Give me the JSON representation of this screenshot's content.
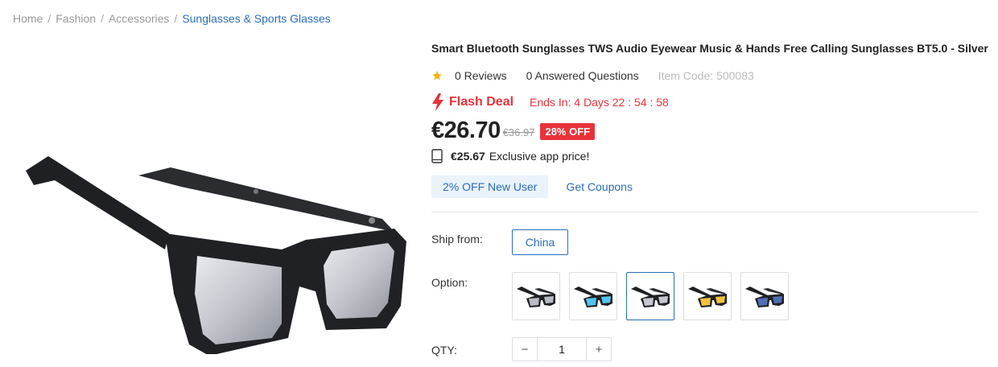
{
  "breadcrumb": {
    "items": [
      "Home",
      "Fashion",
      "Accessories"
    ],
    "current": "Sunglasses & Sports Glasses",
    "separator": "/"
  },
  "product": {
    "title": "Smart Bluetooth Sunglasses TWS Audio Eyewear Music & Hands Free Calling Sunglasses BT5.0 - Silver",
    "reviews": "0 Reviews",
    "questions": "0 Answered Questions",
    "item_code": "Item Code: 500083",
    "image_icon": "sunglasses-image"
  },
  "flash_deal": {
    "label": "Flash Deal",
    "ends_in": "Ends In: 4 Days 22 : 54 : 58",
    "icon": "lightning-bolt-icon"
  },
  "pricing": {
    "price": "€26.70",
    "original_price": "€36.97",
    "discount_badge": "28% OFF",
    "app_price": "€25.67",
    "app_price_text": "Exclusive app price!",
    "app_icon": "phone-icon"
  },
  "coupons": {
    "new_user": "2% OFF New User",
    "get_coupons": "Get Coupons"
  },
  "ship": {
    "label": "Ship from:",
    "value": "China"
  },
  "options": {
    "label": "Option:",
    "lens_colors": [
      "#b9bcc4",
      "#4fc7f2",
      "#c5c8d0",
      "#f2c23a",
      "#4f6fb8"
    ],
    "selected_index": 2
  },
  "quantity": {
    "label": "QTY:",
    "value": "1",
    "minus": "−",
    "plus": "+"
  },
  "colors": {
    "accent_blue": "#2a6ebb",
    "sale_red": "#e8333a",
    "star_yellow": "#f5b619"
  }
}
